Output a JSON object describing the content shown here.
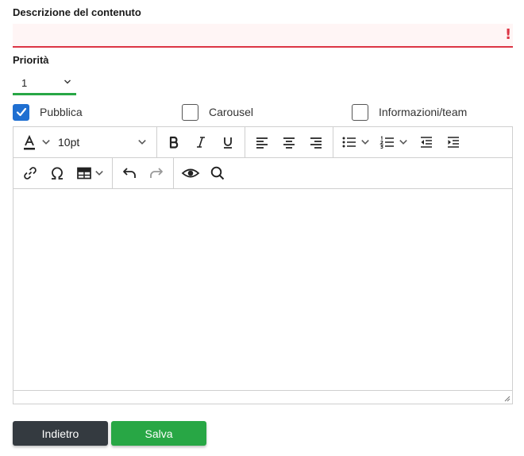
{
  "form": {
    "description_label": "Descrizione del contenuto",
    "description_value": "",
    "description_error_mark": "!",
    "priority_label": "Priorità",
    "priority_value": "1"
  },
  "checkboxes": [
    {
      "label": "Pubblica",
      "checked": true
    },
    {
      "label": "Carousel",
      "checked": false
    },
    {
      "label": "Informazioni/team",
      "checked": false
    }
  ],
  "editor": {
    "font_size": "10pt",
    "content": ""
  },
  "buttons": {
    "back": "Indietro",
    "save": "Salva"
  },
  "colors": {
    "error": "#dc3545",
    "success": "#28a745",
    "checkbox": "#1f6fd1",
    "dark_button": "#343a40"
  }
}
